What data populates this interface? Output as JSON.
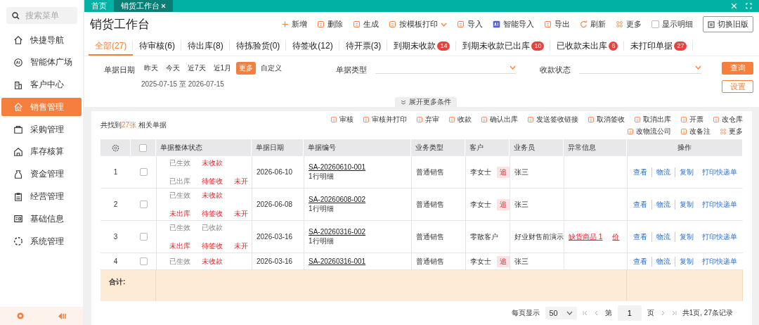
{
  "sidebar": {
    "search": {
      "placeholder": "搜索菜单"
    },
    "items": [
      {
        "label": "快捷导航",
        "selected": false
      },
      {
        "label": "智能体广场",
        "selected": false
      },
      {
        "label": "客户中心",
        "selected": false
      },
      {
        "label": "销售管理",
        "selected": true
      },
      {
        "label": "采购管理",
        "selected": false
      },
      {
        "label": "库存核算",
        "selected": false
      },
      {
        "label": "资金管理",
        "selected": false
      },
      {
        "label": "经营管理",
        "selected": false
      },
      {
        "label": "基础信息",
        "selected": false
      },
      {
        "label": "系统管理",
        "selected": false
      }
    ]
  },
  "top_tabs": [
    {
      "label": "首页",
      "selected": false,
      "closable": false
    },
    {
      "label": "销货工作台",
      "selected": true,
      "closable": true
    }
  ],
  "page": {
    "title": "销货工作台"
  },
  "toolbar": [
    {
      "label": "新增",
      "kind": "button"
    },
    {
      "label": "删除",
      "kind": "button"
    },
    {
      "label": "生成",
      "kind": "button"
    },
    {
      "label": "按模板打印",
      "kind": "dropdown"
    },
    {
      "label": "导入",
      "kind": "button"
    },
    {
      "label": "智能导入",
      "kind": "button"
    },
    {
      "label": "导出",
      "kind": "button"
    },
    {
      "label": "刷新",
      "kind": "button"
    },
    {
      "label": "更多",
      "kind": "button"
    }
  ],
  "show_detail": {
    "label": "显示明细",
    "checked": false
  },
  "switch_button": "切换旧版",
  "status_tabs": [
    {
      "label": "全部(27)",
      "selected": true
    },
    {
      "label": "待审核(6)",
      "selected": false
    },
    {
      "label": "待出库(8)",
      "selected": false
    },
    {
      "label": "待拣验货(0)",
      "selected": false
    },
    {
      "label": "待签收(12)",
      "selected": false
    },
    {
      "label": "待开票(3)",
      "selected": false
    },
    {
      "label": "到期未收款",
      "badge": "14",
      "selected": false
    },
    {
      "label": "到期未收款已出库",
      "badge": "10",
      "selected": false
    },
    {
      "label": "已收款未出库",
      "badge": "6",
      "selected": false
    },
    {
      "label": "未打印单据",
      "badge": "27",
      "selected": false
    }
  ],
  "filters": {
    "date_label": "单据日期",
    "date_chips": [
      {
        "label": "昨天",
        "selected": false
      },
      {
        "label": "今天",
        "selected": false
      },
      {
        "label": "近7天",
        "selected": false
      },
      {
        "label": "近1月",
        "selected": false
      },
      {
        "label": "更多",
        "selected": true
      },
      {
        "label": "自定义",
        "selected": false
      }
    ],
    "date_range": "2025-07-15 至 2026-07-15",
    "selects": [
      {
        "label": "单据类型"
      },
      {
        "label": "收款状态"
      }
    ],
    "query_button": "查询",
    "settings_button": "设置",
    "expand": "展开更多条件"
  },
  "result": {
    "prefix": "共找到",
    "count": "27张",
    "suffix": " 相关单据"
  },
  "action_rows": [
    [
      "审核",
      "审核并打印",
      "弃审",
      "收款",
      "确认出库",
      "发送签收链接",
      "取消签收",
      "取消出库",
      "开票",
      "改仓库"
    ],
    [
      "改物流公司",
      "改备注",
      "更多"
    ]
  ],
  "table": {
    "select_all": {
      "checked": false
    },
    "columns": [
      "单据整体状态",
      "单据日期",
      "单据编号",
      "业务类型",
      "客户",
      "业务员",
      "异常信息",
      "操作"
    ],
    "rows": [
      {
        "index": "1",
        "checked": false,
        "status_lines": [
          [
            {
              "text": "已生效",
              "kind": "ok"
            },
            {
              "text": "未收款",
              "kind": "alert"
            }
          ],
          [
            {
              "text": "已出库",
              "kind": "ok"
            },
            {
              "text": "待签收",
              "kind": "alert"
            },
            {
              "text": "未开",
              "kind": "alert"
            }
          ]
        ],
        "date": "2026-06-10",
        "number": "SA-20260610-001",
        "detail": "1行明细",
        "type": "普通销售",
        "customer": "李女士",
        "customer_tag": "追",
        "salesman": "张三",
        "exceptions": [],
        "actions": [
          "查看",
          "物流",
          "复制",
          "打印快递单"
        ]
      },
      {
        "index": "2",
        "checked": false,
        "status_lines": [
          [
            {
              "text": "已生效",
              "kind": "ok"
            },
            {
              "text": "未收款",
              "kind": "alert"
            }
          ],
          [
            {
              "text": "未出库",
              "kind": "alert"
            },
            {
              "text": "待签收",
              "kind": "alert"
            },
            {
              "text": "未开",
              "kind": "alert"
            }
          ]
        ],
        "date": "2026-06-08",
        "number": "SA-20260608-002",
        "detail": "1行明细",
        "type": "普通销售",
        "customer": "李女士",
        "customer_tag": "追",
        "salesman": "张三",
        "exceptions": [],
        "actions": [
          "查看",
          "物流",
          "复制",
          "打印快递单"
        ]
      },
      {
        "index": "3",
        "checked": false,
        "status_lines": [
          [
            {
              "text": "已生效",
              "kind": "ok"
            },
            {
              "text": "已收款",
              "kind": "ok"
            }
          ],
          [
            {
              "text": "未出库",
              "kind": "alert"
            },
            {
              "text": "待签收",
              "kind": "alert"
            },
            {
              "text": "未开",
              "kind": "alert"
            }
          ]
        ],
        "date": "2026-03-16",
        "number": "SA-20260316-002",
        "detail": "1行明细",
        "type": "普通销售",
        "customer": "零散客户",
        "salesman": "好业财售前演示",
        "exceptions": [
          "缺货商品 1",
          "价"
        ],
        "actions": [
          "查看",
          "物流",
          "复制",
          "打印快递单"
        ]
      },
      {
        "index": "4",
        "checked": false,
        "status_lines": [
          [
            {
              "text": "已生效",
              "kind": "ok"
            },
            {
              "text": "未收款",
              "kind": "alert"
            }
          ]
        ],
        "date": "2026-03-16",
        "number": "SA-20260316-001",
        "type": "普通销售",
        "customer": "李女士",
        "customer_tag": "追",
        "salesman": "张三",
        "exceptions": [],
        "actions": [
          "查看",
          "物流",
          "复制",
          "打印快递单"
        ]
      }
    ],
    "summary_label": "合计:"
  },
  "pagination": {
    "per_page_label": "每页显示",
    "per_page": "50",
    "page_prefix": "第",
    "page": "1",
    "page_suffix": "页",
    "total": "共1页, 27条记录"
  }
}
